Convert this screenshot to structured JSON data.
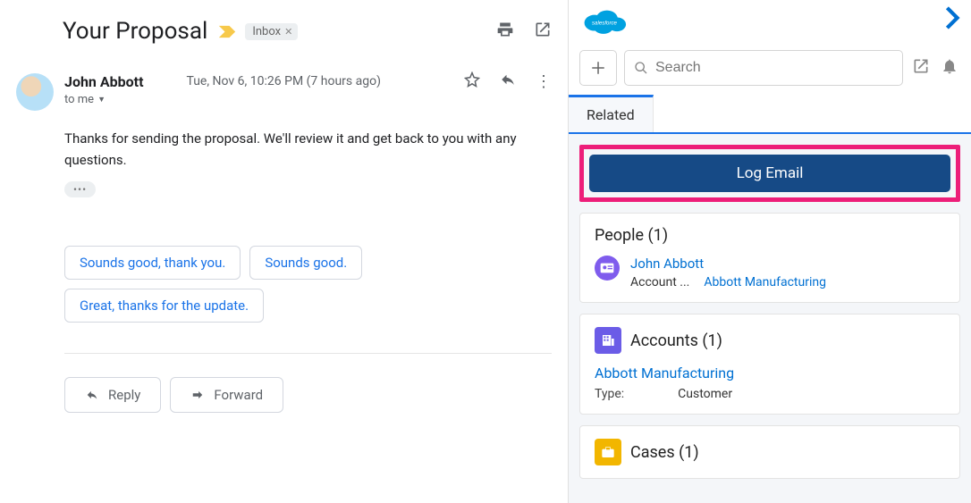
{
  "email": {
    "subject": "Your Proposal",
    "inbox_chip": "Inbox",
    "sender_name": "John Abbott",
    "date_text": "Tue, Nov 6, 10:26 PM (7 hours ago)",
    "to_text": "to me",
    "body_text": "Thanks for sending the proposal. We'll review it and get back to you with any questions.",
    "trimmed": "•••",
    "smart_replies": {
      "r0": "Sounds good, thank you.",
      "r1": "Sounds good.",
      "r2": "Great, thanks for the update."
    },
    "reply_label": "Reply",
    "forward_label": "Forward"
  },
  "salesforce": {
    "brand": "salesforce",
    "search_placeholder": "Search",
    "tab_related": "Related",
    "log_email_label": "Log Email",
    "people": {
      "title": "People (1)",
      "name": "John Abbott",
      "field_label": "Account ...",
      "field_value": "Abbott Manufacturing"
    },
    "accounts": {
      "title": "Accounts (1)",
      "name": "Abbott Manufacturing",
      "type_k": "Type:",
      "type_v": "Customer"
    },
    "cases": {
      "title": "Cases (1)"
    }
  }
}
